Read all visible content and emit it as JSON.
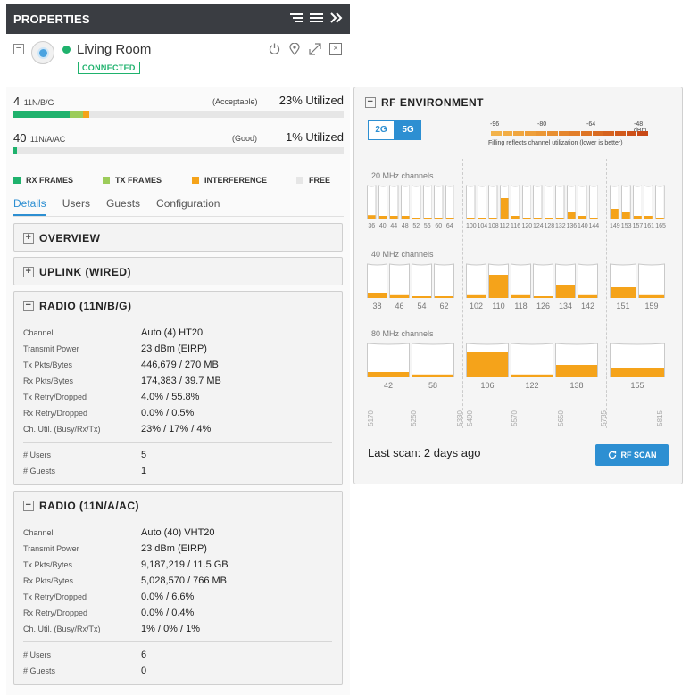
{
  "properties": {
    "title": "PROPERTIES",
    "header_icons": [
      "sort-icon",
      "menu-icon",
      "collapse-right-icon"
    ],
    "device": {
      "name": "Living Room",
      "status": "CONNECTED",
      "icons": [
        "power-icon",
        "locate-icon",
        "expand-icon",
        "close-icon"
      ]
    },
    "bands": [
      {
        "num": "4",
        "mode": "11N/B/G",
        "quality": "(Acceptable)",
        "util": "23% Utilized",
        "segments": [
          {
            "type": "rx",
            "pct": 17
          },
          {
            "type": "tx",
            "pct": 4
          },
          {
            "type": "interference",
            "pct": 2
          }
        ]
      },
      {
        "num": "40",
        "mode": "11N/A/AC",
        "quality": "(Good)",
        "util": "1% Utilized",
        "segments": [
          {
            "type": "rx",
            "pct": 1
          }
        ]
      }
    ],
    "legend": [
      {
        "label": "RX FRAMES",
        "color": "#1fb26d"
      },
      {
        "label": "TX FRAMES",
        "color": "#9ccc5a"
      },
      {
        "label": "INTERFERENCE",
        "color": "#f5a31a"
      },
      {
        "label": "FREE",
        "color": "#e6e6e6"
      }
    ],
    "tabs": [
      "Details",
      "Users",
      "Guests",
      "Configuration"
    ],
    "sections": {
      "overview": "OVERVIEW",
      "uplink": "UPLINK (WIRED)",
      "radio1": {
        "title": "RADIO (11N/B/G)",
        "rows": [
          {
            "k": "Channel",
            "v": "Auto (4) HT20"
          },
          {
            "k": "Transmit Power",
            "v": "23 dBm (EIRP)"
          },
          {
            "k": "Tx Pkts/Bytes",
            "v": "446,679 / 270 MB"
          },
          {
            "k": "Rx Pkts/Bytes",
            "v": "174,383 / 39.7 MB"
          },
          {
            "k": "Tx Retry/Dropped",
            "v": "4.0% / 55.8%"
          },
          {
            "k": "Rx Retry/Dropped",
            "v": "0.0% / 0.5%"
          },
          {
            "k": "Ch. Util. (Busy/Rx/Tx)",
            "v": "23% / 17% / 4%"
          }
        ],
        "users_k": "# Users",
        "users_v": "5",
        "guests_k": "# Guests",
        "guests_v": "1"
      },
      "radio2": {
        "title": "RADIO (11N/A/AC)",
        "rows": [
          {
            "k": "Channel",
            "v": "Auto (40) VHT20"
          },
          {
            "k": "Transmit Power",
            "v": "23 dBm (EIRP)"
          },
          {
            "k": "Tx Pkts/Bytes",
            "v": "9,187,219 / 11.5 GB"
          },
          {
            "k": "Rx Pkts/Bytes",
            "v": "5,028,570 / 766 MB"
          },
          {
            "k": "Tx Retry/Dropped",
            "v": "0.0% / 6.6%"
          },
          {
            "k": "Rx Retry/Dropped",
            "v": "0.0% / 0.4%"
          },
          {
            "k": "Ch. Util. (Busy/Rx/Tx)",
            "v": "1% / 0% / 1%"
          }
        ],
        "users_k": "# Users",
        "users_v": "6",
        "guests_k": "# Guests",
        "guests_v": "0"
      }
    }
  },
  "rf": {
    "title": "RF ENVIRONMENT",
    "bands": [
      "2G",
      "5G"
    ],
    "active_band": "5G",
    "dbm_labels": [
      "-96",
      "-80",
      "-64",
      "-48 dBm"
    ],
    "note": "Filling reflects channel utilization (lower is better)",
    "w20_label": "20 MHz channels",
    "w40_label": "40 MHz channels",
    "w80_label": "80 MHz channels",
    "w20": {
      "groups": [
        {
          "channels": [
            "36",
            "40",
            "44",
            "48",
            "52",
            "56",
            "60",
            "64"
          ],
          "util": [
            0.12,
            0.1,
            0.1,
            0.1,
            0.05,
            0.05,
            0.05,
            0.05
          ]
        },
        {
          "channels": [
            "100",
            "104",
            "108",
            "112",
            "116",
            "120",
            "124",
            "128",
            "132",
            "136",
            "140",
            "144"
          ],
          "util": [
            0.05,
            0.05,
            0.05,
            0.6,
            0.1,
            0.05,
            0.05,
            0.05,
            0.05,
            0.2,
            0.1,
            0.05
          ]
        },
        {
          "channels": [
            "149",
            "153",
            "157",
            "161",
            "165"
          ],
          "util": [
            0.3,
            0.2,
            0.1,
            0.1,
            0.05
          ]
        }
      ]
    },
    "w40": {
      "groups": [
        {
          "channels": [
            "38",
            "46",
            "54",
            "62"
          ],
          "util": [
            0.15,
            0.08,
            0.05,
            0.05
          ]
        },
        {
          "channels": [
            "102",
            "110",
            "118",
            "126",
            "134",
            "142"
          ],
          "util": [
            0.08,
            0.65,
            0.08,
            0.05,
            0.35,
            0.08
          ]
        },
        {
          "channels": [
            "151",
            "159"
          ],
          "util": [
            0.3,
            0.08
          ]
        }
      ]
    },
    "w80": {
      "groups": [
        {
          "channels": [
            "42",
            "58"
          ],
          "util": [
            0.15,
            0.08
          ]
        },
        {
          "channels": [
            "106",
            "122",
            "138"
          ],
          "util": [
            0.7,
            0.08,
            0.35
          ]
        },
        {
          "channels": [
            "155"
          ],
          "util": [
            0.25
          ]
        }
      ]
    },
    "freqs": [
      "5170",
      "5250",
      "5330",
      "5490",
      "5570",
      "5650",
      "5735",
      "5815"
    ],
    "scan_text": "Last scan: 2 days ago",
    "scan_button": "RF SCAN"
  }
}
